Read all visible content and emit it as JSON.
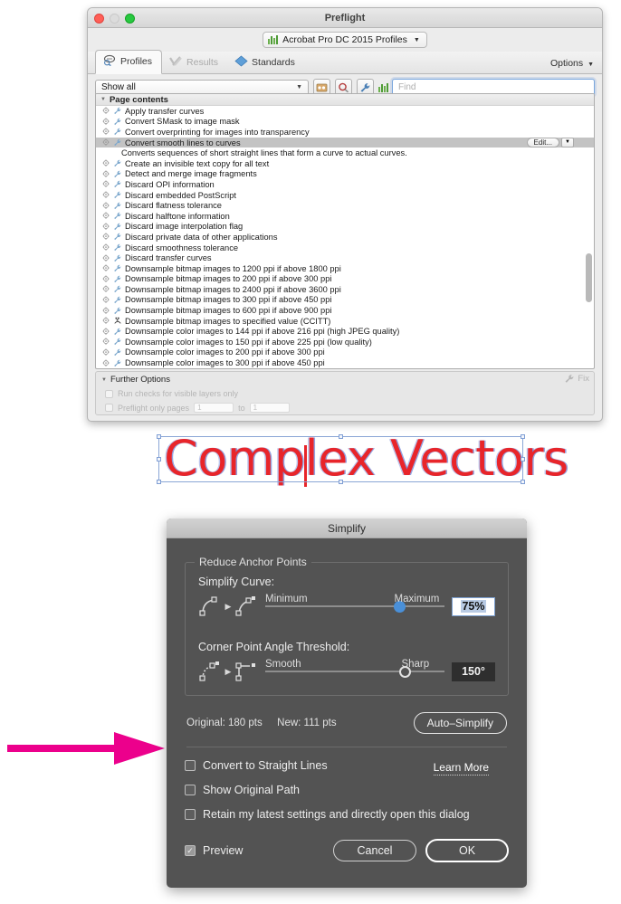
{
  "preflight": {
    "window_title": "Preflight",
    "traffic_lights": [
      "close",
      "minimize",
      "zoom"
    ],
    "profile_chip": {
      "label": "Acrobat Pro DC 2015 Profiles",
      "icon": "bar-chart-icon"
    },
    "tabs": [
      {
        "id": "profiles",
        "label": "Profiles",
        "icon": "magnifier-profile-icon",
        "active": true,
        "disabled": false
      },
      {
        "id": "results",
        "label": "Results",
        "icon": "check-x-icon",
        "active": false,
        "disabled": true
      },
      {
        "id": "standards",
        "label": "Standards",
        "icon": "diamond-icon",
        "active": false,
        "disabled": false
      }
    ],
    "options_label": "Options",
    "filter": {
      "show_all_value": "Show all",
      "tool_icons": [
        "profile-group-icon",
        "search-icon",
        "wrench-icon",
        "bar-chart-icon"
      ],
      "find_placeholder": "Find"
    },
    "list": {
      "group_header": "Page contents",
      "selected_index": 3,
      "selected_description": "Converts sequences of short straight lines that form a curve to actual curves.",
      "edit_button": "Edit...",
      "items": [
        "Apply transfer curves",
        "Convert SMask to image mask",
        "Convert overprinting for images into transparency",
        "Convert smooth lines to curves",
        "Create an invisible text copy for all text",
        "Detect and merge image fragments",
        "Discard OPI information",
        "Discard embedded PostScript",
        "Discard flatness tolerance",
        "Discard halftone information",
        "Discard image interpolation flag",
        "Discard private data of other applications",
        "Discard smoothness tolerance",
        "Discard transfer curves",
        "Downsample bitmap images to 1200 ppi if above 1800 ppi",
        "Downsample bitmap images to 200 ppi if above 300 ppi",
        "Downsample bitmap images to 2400 ppi if above 3600 ppi",
        "Downsample bitmap images to 300 ppi if above 450 ppi",
        "Downsample bitmap images to 600 ppi if above 900 ppi",
        "Downsample bitmap images to specified value (CCITT)",
        "Downsample color images to 144 ppi if above 216 ppi (high JPEG quality)",
        "Downsample color images to 150 ppi if above 225 ppi (low quality)",
        "Downsample color images to 200 ppi if above 300 ppi",
        "Downsample color images to 300 ppi if above 450 ppi"
      ]
    },
    "further_options": {
      "header": "Further Options",
      "fix_button": "Fix",
      "visible_layers_label": "Run checks for visible layers only",
      "visible_layers_checked": false,
      "only_pages_label": "Preflight only pages",
      "only_pages_checked": false,
      "page_from": "1",
      "page_to_label": "to",
      "page_to": "1"
    }
  },
  "artwork": {
    "text": "Complex Vectors",
    "text_color": "#e8252a",
    "selection_color": "#8aa6d6"
  },
  "annotation": {
    "arrow_color": "#ec008c",
    "arrow_direction": "right"
  },
  "simplify": {
    "title": "Simplify",
    "group_legend": "Reduce Anchor Points",
    "simplify_curve": {
      "label": "Simplify Curve:",
      "min_label": "Minimum",
      "max_label": "Maximum",
      "value": "75%",
      "slider_percent": 75,
      "knob_style": "filled",
      "knob_color": "#4a90d9",
      "icon_left": "smooth-curve-point-icon",
      "icon_arrow": "play-triangle-icon",
      "icon_right": "anchor-point-icon"
    },
    "corner_point": {
      "label": "Corner Point Angle Threshold:",
      "min_label": "Smooth",
      "max_label": "Sharp",
      "value": "150°",
      "slider_percent": 78,
      "knob_style": "hollow",
      "icon_left": "corner-curve-point-icon",
      "icon_arrow": "play-triangle-icon",
      "icon_right": "corner-anchor-point-icon"
    },
    "stats": {
      "original_label": "Original: 180 pts",
      "new_label": "New: 111 pts"
    },
    "auto_simplify_label": "Auto–Simplify",
    "checkboxes": [
      {
        "label": "Convert to Straight Lines",
        "checked": false
      },
      {
        "label": "Show Original Path",
        "checked": false
      },
      {
        "label": "Retain my latest settings and directly open this dialog",
        "checked": false
      }
    ],
    "learn_more_label": "Learn More",
    "preview": {
      "label": "Preview",
      "checked": true
    },
    "cancel_label": "Cancel",
    "ok_label": "OK"
  }
}
